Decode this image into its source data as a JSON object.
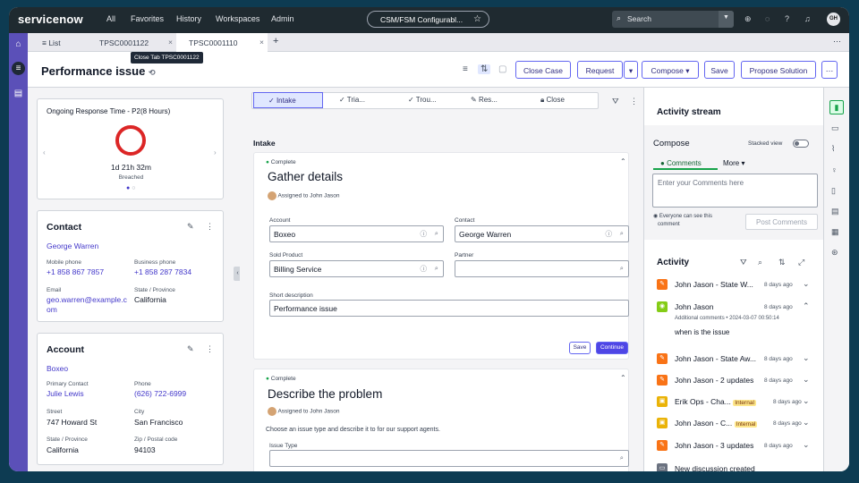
{
  "topbar": {
    "logo": "servicenow",
    "nav": [
      "All",
      "Favorites",
      "History",
      "Workspaces",
      "Admin"
    ],
    "workspace_pill": "CSM/FSM Configurabl...",
    "search_placeholder": "Search",
    "avatar": "GH"
  },
  "tabs": {
    "list": "List",
    "tab1": "TPSC0001122",
    "tab2": "TPSC0001110",
    "add": "+",
    "tooltip": "Close Tab TPSC0001122"
  },
  "header": {
    "title": "Performance issue",
    "buttons": [
      "Close Case",
      "Request",
      "Compose",
      "Save",
      "Propose Solution"
    ]
  },
  "response_card": {
    "title": "Ongoing Response Time - P2(8 Hours)",
    "elapsed": "1d 21h 32m",
    "status": "Breached",
    "progress": 1.0
  },
  "contact_card": {
    "title": "Contact",
    "name": "George Warren",
    "mobile_label": "Mobile phone",
    "mobile": "+1 858 867 7857",
    "business_label": "Business phone",
    "business": "+1 858 287 7834",
    "email_label": "Email",
    "email_line1": "geo.warren@example.c",
    "email_line2": "om",
    "state_label": "State / Province",
    "state": "California"
  },
  "account_card": {
    "title": "Account",
    "name": "Boxeo",
    "primary_label": "Primary Contact",
    "primary": "Julie Lewis",
    "phone_label": "Phone",
    "phone": "(626) 722-6999",
    "street_label": "Street",
    "street": "747 Howard St",
    "city_label": "City",
    "city": "San Francisco",
    "state_label": "State / Province",
    "state": "California",
    "zip_label": "Zip / Postal code",
    "zip": "94103"
  },
  "stages": [
    "Intake",
    "Tria...",
    "Trou...",
    "Res...",
    "Close"
  ],
  "intake": {
    "heading": "Intake",
    "status": "Complete",
    "title": "Gather details",
    "assigned": "Assigned to John Jason",
    "account_label": "Account",
    "account": "Boxeo",
    "contact_label": "Contact",
    "contact": "George Warren",
    "product_label": "Sold Product",
    "product": "Billing Service",
    "partner_label": "Partner",
    "partner": "",
    "desc_label": "Short description",
    "desc": "Performance issue",
    "save": "Save",
    "continue": "Continue"
  },
  "problem": {
    "status": "Complete",
    "title": "Describe the problem",
    "assigned": "Assigned to John Jason",
    "instructions": "Choose an issue type and describe it to for our support agents.",
    "issue_label": "Issue Type"
  },
  "activity_stream": {
    "title": "Activity stream",
    "compose": "Compose",
    "stacked": "Stacked view",
    "tab_comments": "Comments",
    "tab_more": "More",
    "placeholder": "Enter your Comments here",
    "visibility": "Everyone can see this",
    "visibility2": "comment",
    "post": "Post Comments",
    "activity_title": "Activity",
    "items": [
      {
        "name": "John Jason - State W...",
        "date": "8 days ago",
        "color": "#f97316",
        "icon": "pencil-icon"
      },
      {
        "name": "John Jason",
        "date": "8 days ago",
        "color": "#84cc16",
        "icon": "eye-icon",
        "detail": "Additional comments  •  2024-03-07 00:50:14",
        "comment": "when is the issue"
      },
      {
        "name": "John Jason - State Aw...",
        "date": "8 days ago",
        "color": "#f97316",
        "icon": "pencil-icon"
      },
      {
        "name": "John Jason - 2 updates",
        "date": "8 days ago",
        "color": "#f97316",
        "icon": "pencil-icon"
      },
      {
        "name": "Erik Ops - Cha...",
        "badge": "Internal",
        "date": "8 days ago",
        "color": "#eab308",
        "icon": "lock-icon"
      },
      {
        "name": "John Jason - C...",
        "badge": "Internal",
        "date": "8 days ago",
        "color": "#eab308",
        "icon": "lock-icon"
      },
      {
        "name": "John Jason - 3 updates",
        "date": "8 days ago",
        "color": "#f97316",
        "icon": "pencil-icon"
      },
      {
        "name": "New discussion created",
        "date": "",
        "color": "#6b7280",
        "icon": "chat-icon"
      }
    ]
  }
}
